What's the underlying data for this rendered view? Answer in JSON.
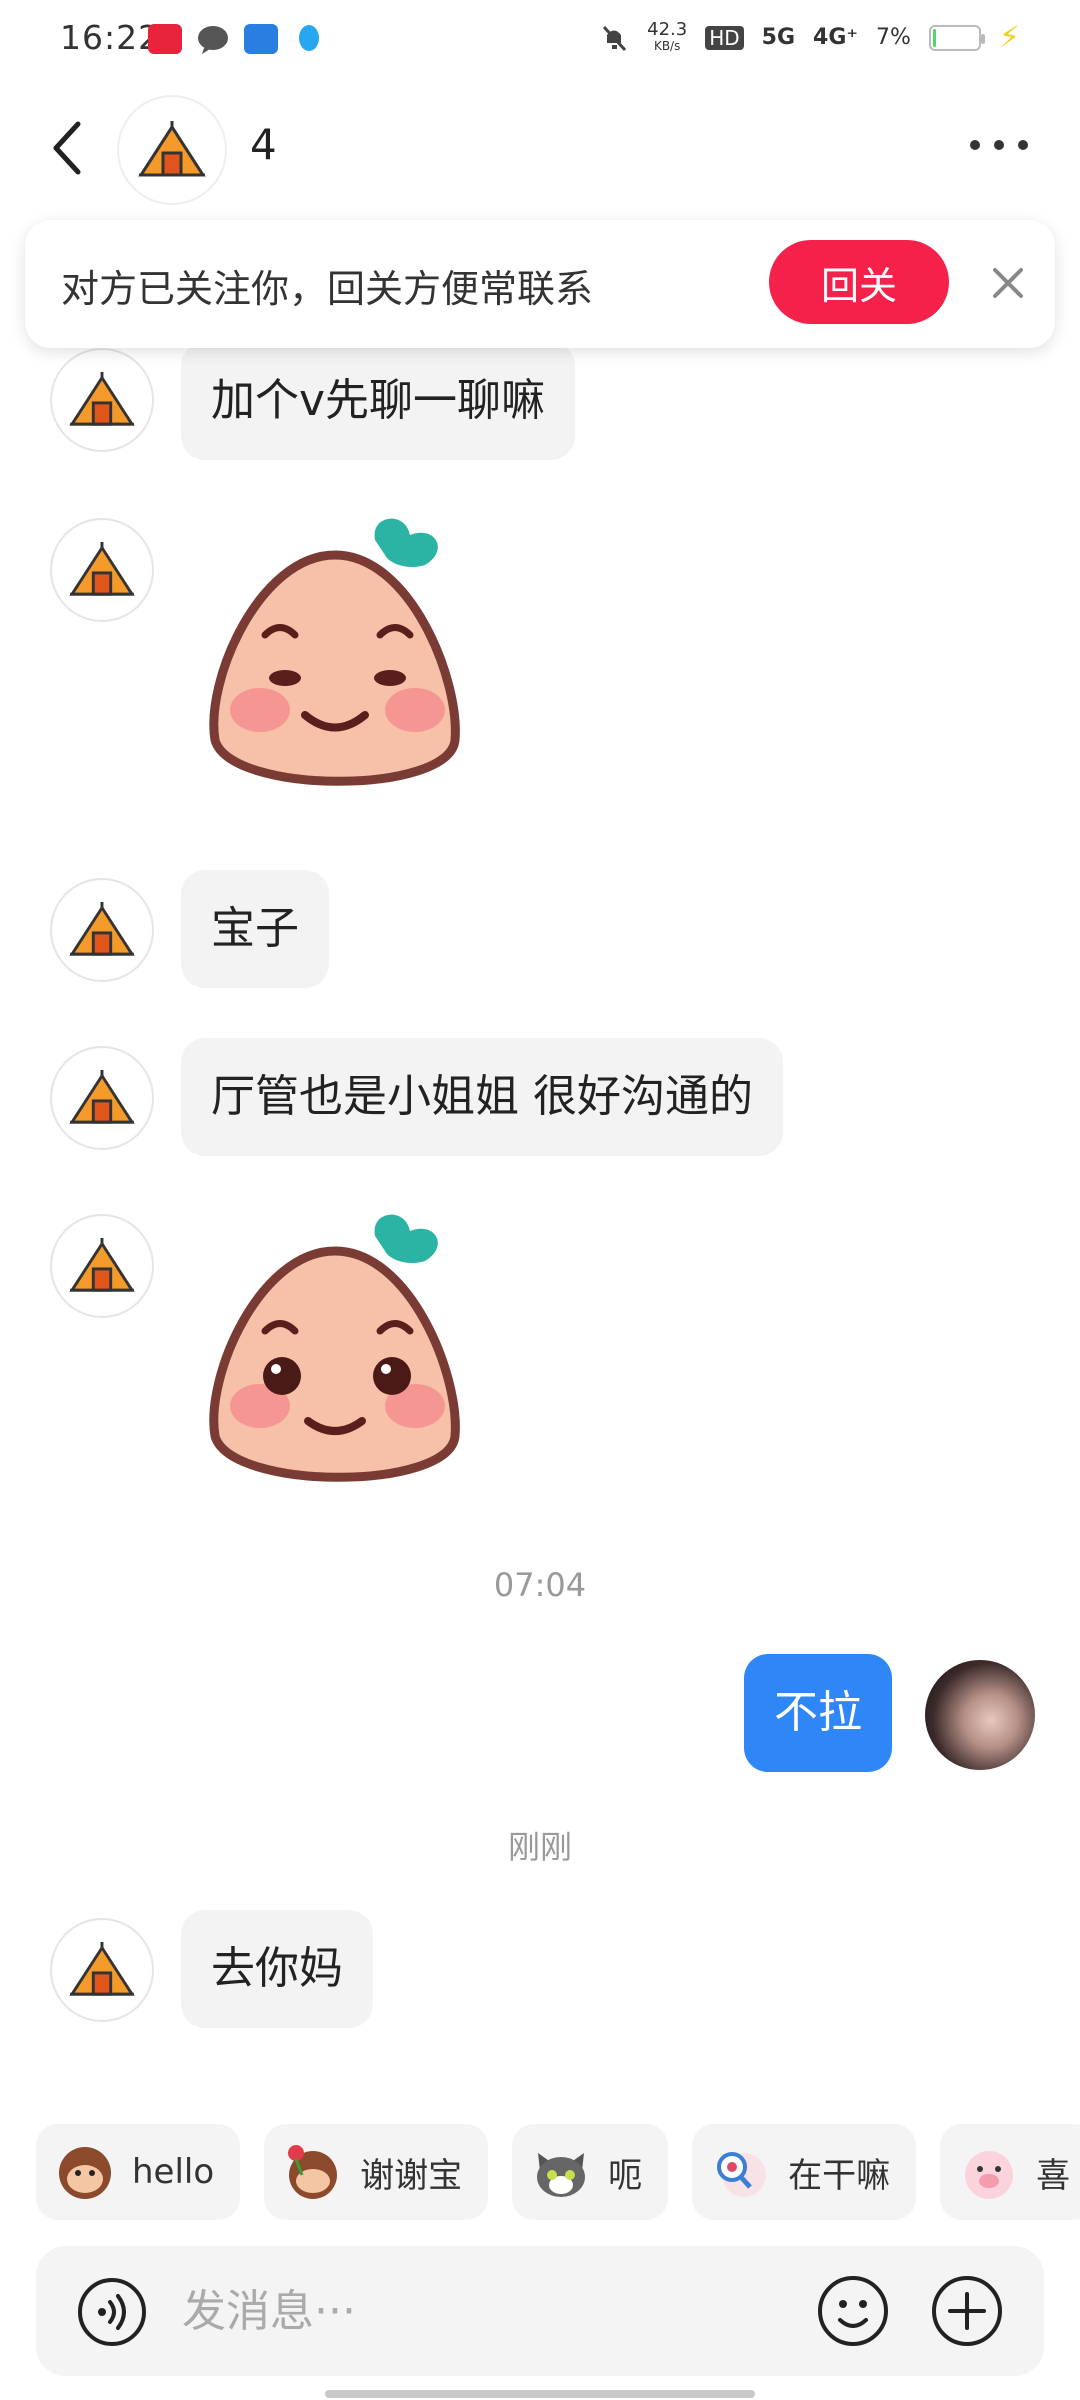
{
  "status_bar": {
    "time": "16:22",
    "net_speed": "42.3",
    "net_unit": "KB/s",
    "hd": "HD",
    "sig1": "5G",
    "sig2": "4G⁺",
    "battery": "7%",
    "battery_level": 0.07
  },
  "header": {
    "contact_name": "4"
  },
  "banner": {
    "text": "对方已关注你，回关方便常联系",
    "follow_back_label": "回关"
  },
  "messages": [
    {
      "text": "加个v先聊一聊嘛"
    },
    {
      "text": "宝子"
    },
    {
      "text": "厅管也是小姐姐 很好沟通的"
    }
  ],
  "time_1": "07:04",
  "my_message": "不拉",
  "time_2": "刚刚",
  "last_message": "去你妈",
  "quick_replies": [
    {
      "label": "hello",
      "icon": "monkey-hello-icon"
    },
    {
      "label": "谢谢宝",
      "icon": "monkey-rose-icon"
    },
    {
      "label": "呃",
      "icon": "cat-icon"
    },
    {
      "label": "在干嘛",
      "icon": "magnifier-doll-icon"
    },
    {
      "label": "喜",
      "icon": "pig-icon"
    }
  ],
  "input": {
    "placeholder": "发消息···"
  },
  "colors": {
    "accent_red": "#f4214a",
    "my_bubble": "#2f86f7",
    "bubble_gray": "#f3f3f3"
  }
}
